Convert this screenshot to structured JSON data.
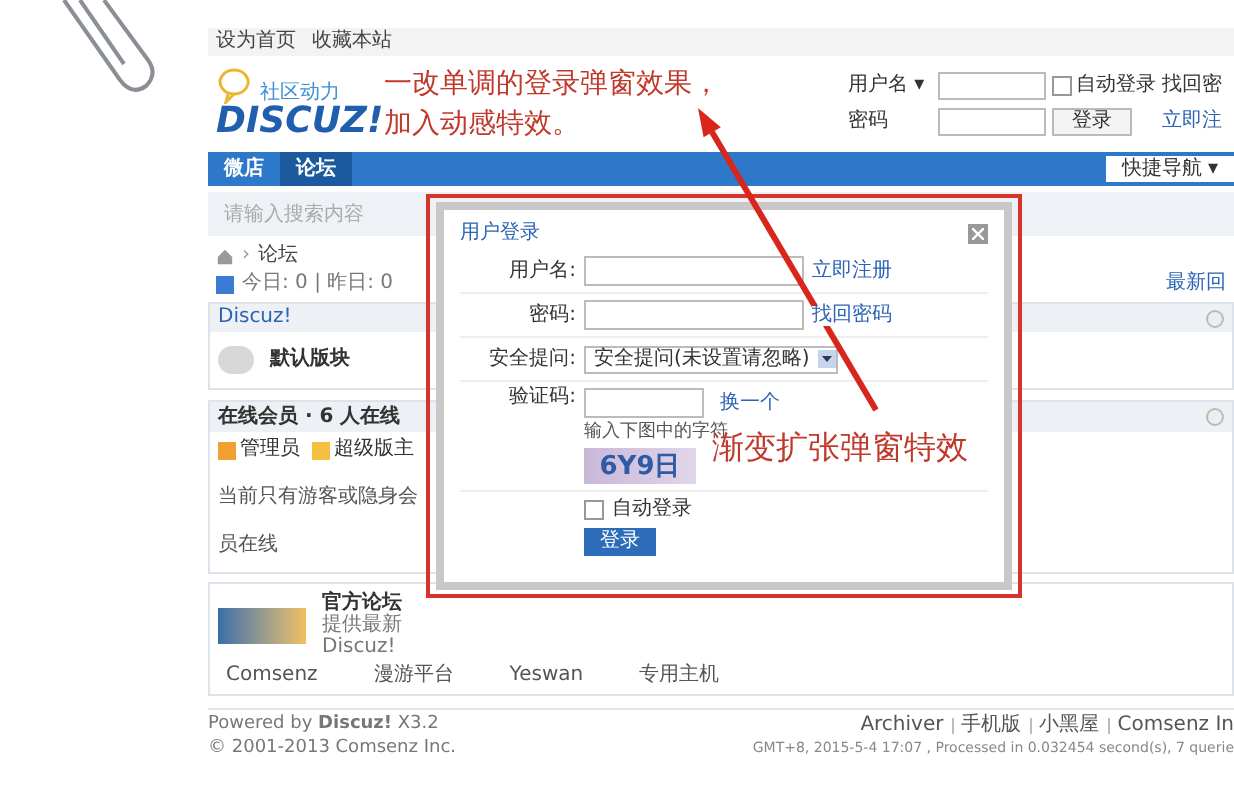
{
  "header_note": {
    "lines": [
      "一改单调的登录弹窗效果，",
      "加入动感特效。"
    ]
  },
  "popup_note": "渐变扩张弹窗特效",
  "top_links": [
    "设为首页",
    "收藏本站"
  ],
  "logo": {
    "tagline": "社区动力",
    "wordmark": "DISCUZ!"
  },
  "login_bar": {
    "username_label": "用户名 ▾",
    "password_label": "密码",
    "autologin": {
      "label": "自动登录",
      "checked": false
    },
    "forgot": "找回密",
    "login_button": "登录",
    "register": "立即注"
  },
  "nav": {
    "items": [
      {
        "label": "微店",
        "selected": false
      },
      {
        "label": "论坛",
        "selected": true
      }
    ],
    "quick_nav": "快捷导航 ▾"
  },
  "search": {
    "placeholder": "请输入搜索内容"
  },
  "breadcrumb_separator": "›",
  "breadcrumb": [
    "论坛"
  ],
  "stats": "今日: 0 | 昨日: 0",
  "latest_reply": "最新回",
  "category": {
    "title": "Discuz!",
    "forums": [
      {
        "name": "默认版块"
      }
    ]
  },
  "online": {
    "title": "在线会员 · 6 人在线",
    "legend": [
      {
        "label": "管理员",
        "color": "#f0a030"
      },
      {
        "label": "超级版主",
        "color": "#f5c040"
      }
    ],
    "note": "当前只有游客或隐身会员在线"
  },
  "links": {
    "featured": {
      "title": "官方论坛",
      "desc": "提供最新 Discuz!"
    },
    "items": [
      "Comsenz",
      "漫游平台",
      "Yeswan",
      "专用主机"
    ]
  },
  "footer": {
    "powered": "Powered by **Discuz!** X3.2",
    "copyright": "© 2001-2013 Comsenz Inc.",
    "links": [
      "Archiver",
      "手机版",
      "小黑屋",
      "Comsenz In"
    ],
    "time": "GMT+8, 2015-5-4 17:07 , Processed in 0.032454 second(s), 7 querie"
  },
  "dialog": {
    "title": "用户登录",
    "fields": [
      {
        "kind": "text",
        "label": "用户名:",
        "link": "立即注册"
      },
      {
        "kind": "password",
        "label": "密码:",
        "link": "找回密码"
      },
      {
        "kind": "select",
        "label": "安全提问:",
        "value": "安全提问(未设置请忽略)"
      },
      {
        "kind": "captcha",
        "label": "验证码:",
        "link": "换一个",
        "hint": "输入下图中的字符",
        "code": "6Y9日"
      }
    ],
    "remember": {
      "label": "自动登录",
      "checked": false
    },
    "submit": "登录"
  }
}
